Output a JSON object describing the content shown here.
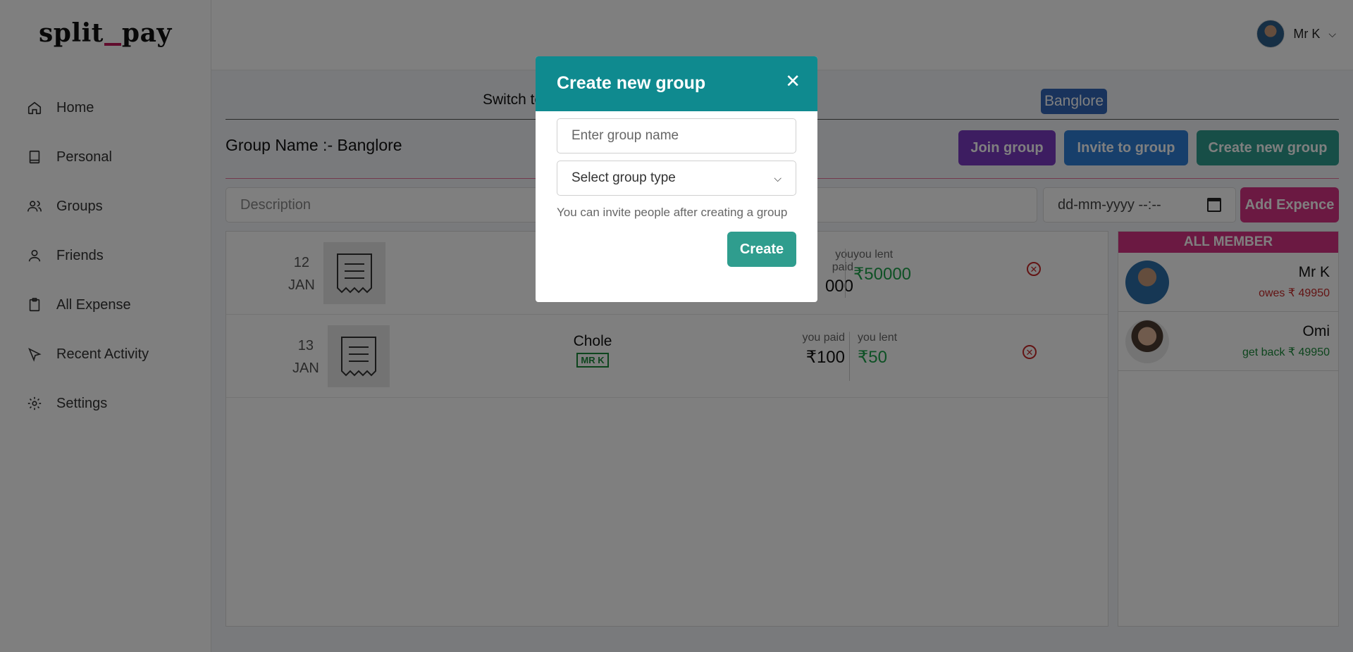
{
  "app": {
    "logo_left": "split",
    "logo_right": "pay"
  },
  "sidebar": {
    "items": [
      {
        "label": "Home",
        "icon": "home-icon"
      },
      {
        "label": "Personal",
        "icon": "book-icon"
      },
      {
        "label": "Groups",
        "icon": "users-icon"
      },
      {
        "label": "Friends",
        "icon": "user-icon"
      },
      {
        "label": "All Expense",
        "icon": "clipboard-icon"
      },
      {
        "label": "Recent Activity",
        "icon": "cursor-icon"
      },
      {
        "label": "Settings",
        "icon": "gear-icon"
      }
    ]
  },
  "topbar": {
    "user_name": "Mr K"
  },
  "main": {
    "switch_label": "Switch to",
    "group_pill": "Banglore",
    "group_name": "Group Name :- Banglore",
    "buttons": {
      "join": "Join group",
      "invite": "Invite to group",
      "create": "Create new group",
      "add": "Add Expence"
    },
    "description_placeholder": "Description",
    "date_placeholder": "dd-mm-yyyy --:--"
  },
  "expenses": [
    {
      "day": "12",
      "month": "JAN",
      "paid_label": "you paid",
      "paid_value": "000",
      "lent_label": "you lent",
      "lent_value": "₹50000"
    },
    {
      "day": "13",
      "month": "JAN",
      "name": "Chole",
      "tag": "MR K",
      "paid_label": "you paid",
      "paid_value": "₹100",
      "lent_label": "you lent",
      "lent_value": "₹50"
    }
  ],
  "members": {
    "title": "ALL MEMBER",
    "list": [
      {
        "name": "Mr K",
        "status": "owes ₹ 49950",
        "status_color": "#c62828"
      },
      {
        "name": "Omi",
        "status": "get back ₹ 49950",
        "status_color": "#1b8a3b"
      }
    ]
  },
  "modal": {
    "title": "Create new group",
    "name_placeholder": "Enter group name",
    "type_placeholder": "Select group type",
    "help": "You can invite people after creating a group",
    "create": "Create"
  },
  "colors": {
    "teal": "#0f8a8f",
    "pink": "#d63384",
    "purple": "#7b3ac2",
    "blue": "#2f7fd6",
    "green": "#2f9d8e"
  }
}
